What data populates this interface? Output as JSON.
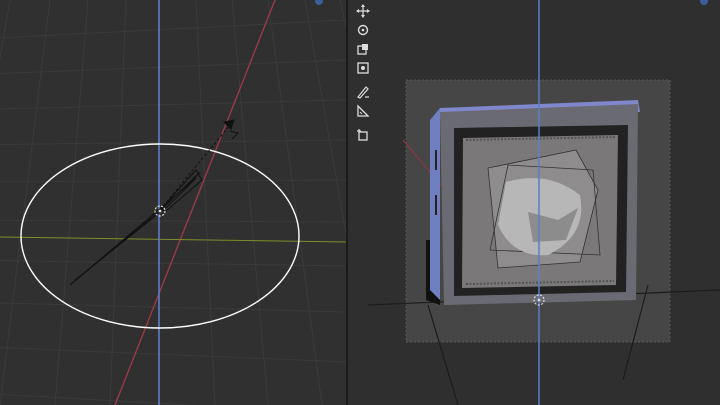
{
  "viewports": {
    "left": {
      "label": ""
    },
    "right": {
      "label": ""
    }
  },
  "toolbar": {
    "tools": [
      {
        "id": "move",
        "icon": "move-icon"
      },
      {
        "id": "rotate",
        "icon": "rotate-icon"
      },
      {
        "id": "scale",
        "icon": "scale-icon"
      },
      {
        "id": "transform",
        "icon": "transform-icon"
      },
      {
        "id": "annotate",
        "icon": "annotate-pencil-icon"
      },
      {
        "id": "measure",
        "icon": "measure-ruler-icon"
      },
      {
        "id": "add-cube",
        "icon": "add-cube-icon"
      }
    ]
  },
  "colors": {
    "viewport_bg": "#303030",
    "grid": "#3a3a3a",
    "x_axis": "#9b3a45",
    "y_axis": "#7d8e2a",
    "z_axis": "#5c7fc6",
    "selection": "#ffffff",
    "camera_frame_bg": "#4a4a4a",
    "object_tint": "#7d84c8"
  }
}
